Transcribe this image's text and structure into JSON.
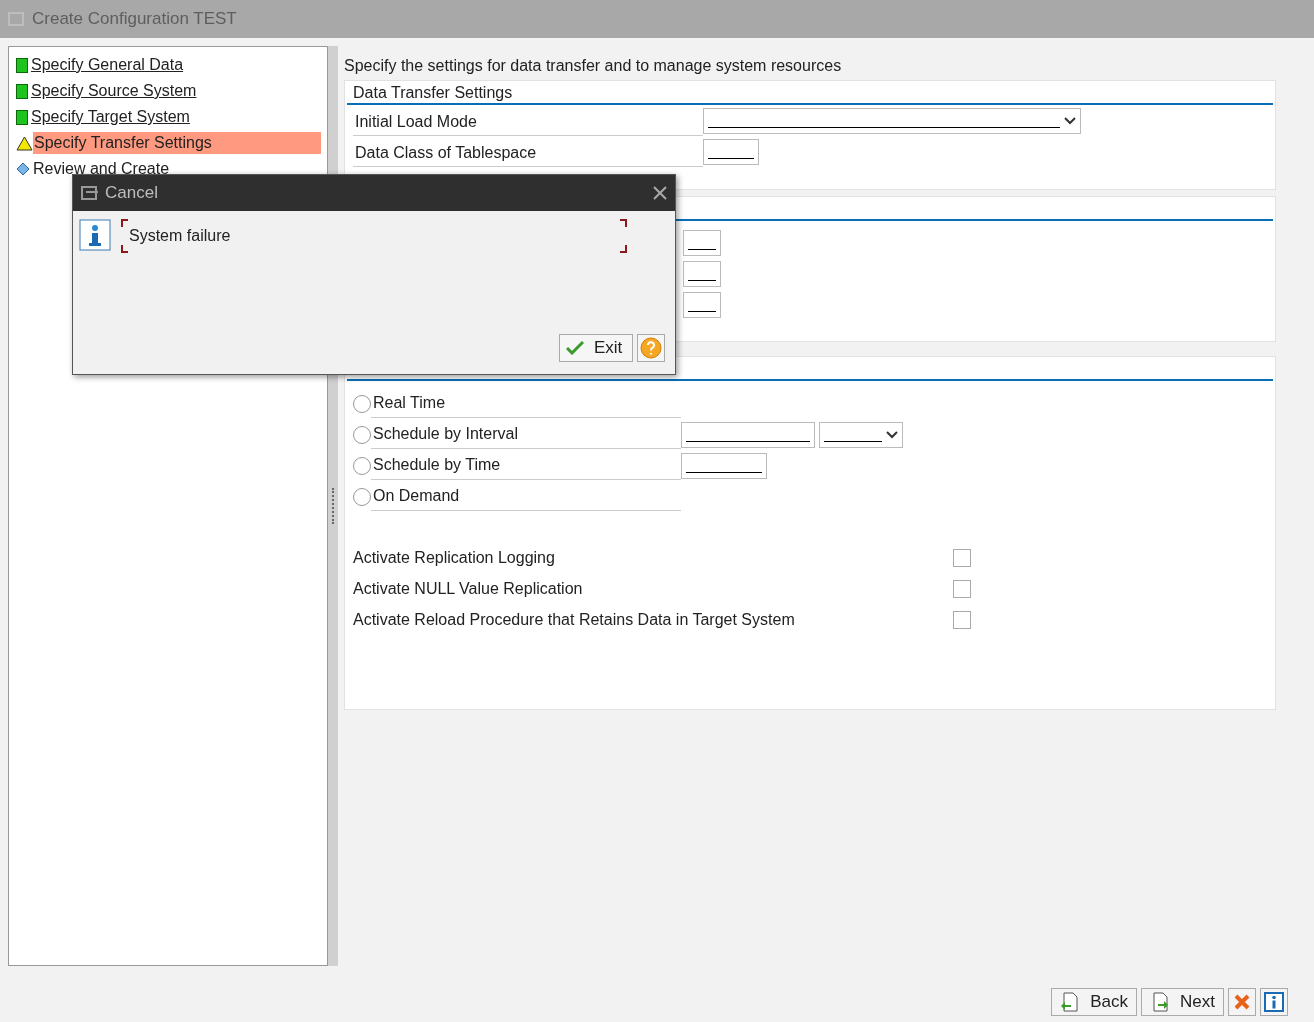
{
  "window": {
    "title": "Create Configuration TEST"
  },
  "steps": [
    {
      "label": "Specify General Data",
      "kind": "done",
      "selected": false
    },
    {
      "label": "Specify Source System",
      "kind": "done",
      "selected": false
    },
    {
      "label": "Specify Target System",
      "kind": "done",
      "selected": false
    },
    {
      "label": "Specify Transfer Settings",
      "kind": "warning",
      "selected": true
    },
    {
      "label": "Review and Create",
      "kind": "pending",
      "selected": false
    }
  ],
  "description": "Specify the settings for data transfer and to manage system resources",
  "data_transfer_settings": {
    "title": "Data Transfer Settings",
    "fields": [
      {
        "label": "Initial Load Mode",
        "kind": "dropdown"
      },
      {
        "label": "Data Class of Tablespace",
        "kind": "text"
      }
    ]
  },
  "group_2": {
    "fields": [
      {
        "kind": "small"
      },
      {
        "kind": "small"
      },
      {
        "kind": "small"
      }
    ]
  },
  "group_3": {
    "options": [
      {
        "label": "Real Time",
        "selected": false
      },
      {
        "label": "Schedule by Interval",
        "selected": false,
        "inputs": [
          {
            "kind": "text"
          },
          {
            "kind": "dropdown"
          }
        ]
      },
      {
        "label": "Schedule by Time",
        "selected": false,
        "inputs": [
          {
            "kind": "time"
          }
        ]
      },
      {
        "label": "On Demand",
        "selected": false
      }
    ],
    "checkboxes": [
      {
        "label": "Activate Replication Logging",
        "checked": false
      },
      {
        "label": "Activate NULL Value Replication",
        "checked": false
      },
      {
        "label": "Activate Reload Procedure that Retains Data in Target System",
        "checked": false
      }
    ]
  },
  "dialog": {
    "title": "Cancel",
    "message": "System failure",
    "button": "Exit"
  },
  "footer": {
    "buttons": [
      {
        "label": "Back",
        "kind": "back"
      },
      {
        "label": "Next",
        "kind": "next"
      },
      {
        "kind": "cancel"
      },
      {
        "kind": "info"
      }
    ]
  }
}
